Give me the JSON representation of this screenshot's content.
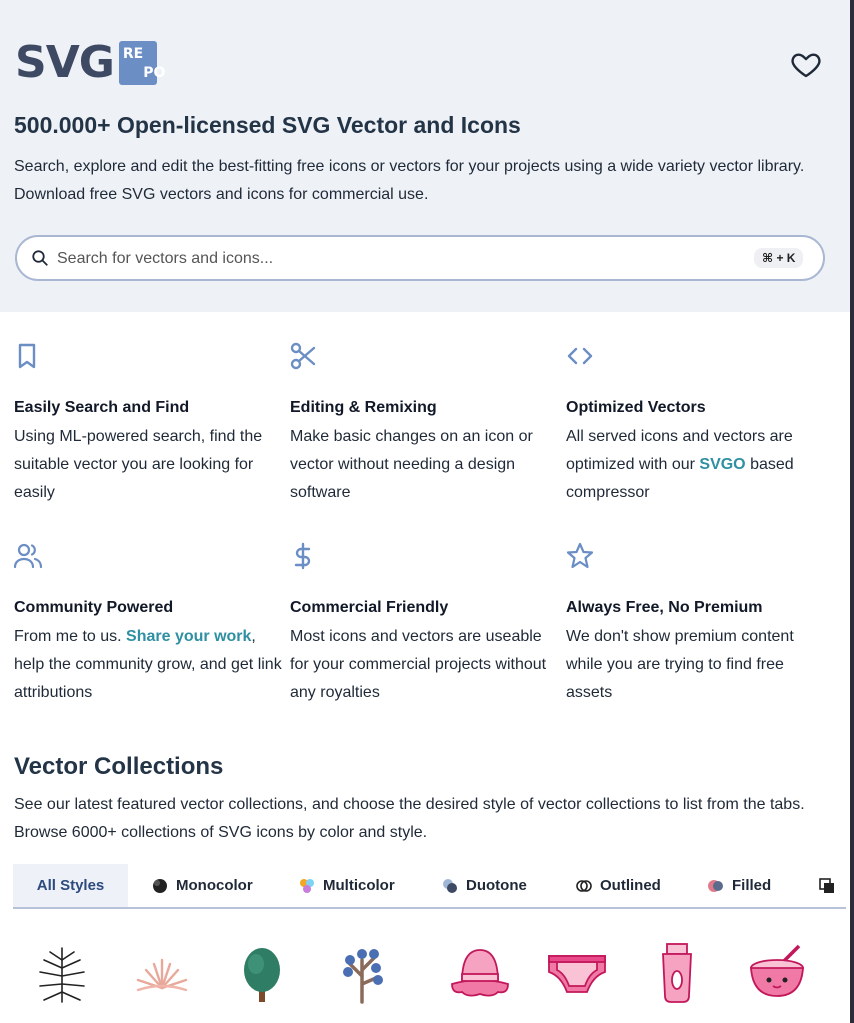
{
  "header": {
    "logo_main": "SVG",
    "logo_box": [
      "RE",
      "PO"
    ],
    "favorites_icon": "heart-icon"
  },
  "hero": {
    "title": "500.000+ Open-licensed SVG Vector and Icons",
    "description": "Search, explore and edit the best-fitting free icons or vectors for your projects using a wide variety vector library. Download free SVG vectors and icons for commercial use.",
    "search_placeholder": "Search for vectors and icons...",
    "shortcut": "⌘ + K"
  },
  "features": [
    {
      "icon": "bookmark-icon",
      "title": "Easily Search and Find",
      "text": "Using ML-powered search, find the suitable vector you are looking for easily"
    },
    {
      "icon": "scissors-icon",
      "title": "Editing & Remixing",
      "text": "Make basic changes on an icon or vector without needing a design software"
    },
    {
      "icon": "code-icon",
      "title": "Optimized Vectors",
      "text_before": "All served icons and vectors are optimized with our ",
      "link": "SVGO",
      "text_after": " based compressor"
    },
    {
      "icon": "users-icon",
      "title": "Community Powered",
      "text_before": "From me to us. ",
      "link": "Share your work",
      "text_after": ", help the community grow, and get link attributions"
    },
    {
      "icon": "dollar-icon",
      "title": "Commercial Friendly",
      "text": "Most icons and vectors are useable for your commercial projects without any royalties"
    },
    {
      "icon": "star-icon",
      "title": "Always Free, No Premium",
      "text": "We don't show premium content while you are trying to find free assets"
    }
  ],
  "collections": {
    "title": "Vector Collections",
    "description": "See our latest featured vector collections, and choose the desired style of vector collections to list from the tabs. Browse 6000+ collections of SVG icons by color and style.",
    "tabs": [
      {
        "label": "All Styles",
        "active": true
      },
      {
        "label": "Monocolor"
      },
      {
        "label": "Multicolor"
      },
      {
        "label": "Duotone"
      },
      {
        "label": "Outlined"
      },
      {
        "label": "Filled"
      }
    ],
    "preview_icons": [
      "palm-leaf-icon",
      "coral-plant-icon",
      "green-tree-icon",
      "blue-berry-tree-icon",
      "pink-hat-icon",
      "diaper-icon",
      "epilator-icon",
      "bowl-face-icon"
    ]
  },
  "colors": {
    "hero_bg": "#eef2f7",
    "accent_link": "#2f8fa3",
    "icon_blue": "#6b8ec5",
    "logo_text": "#3e4a63"
  }
}
